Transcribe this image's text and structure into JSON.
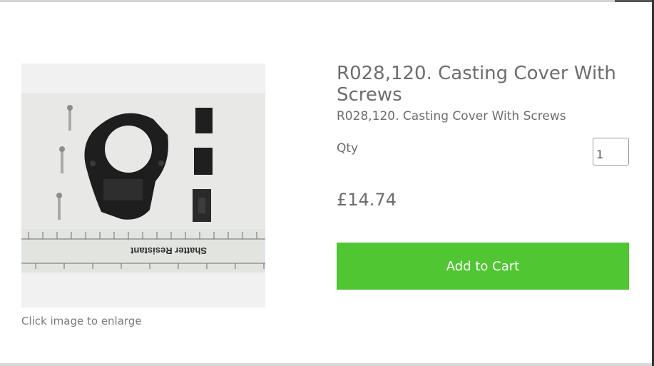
{
  "product": {
    "title": "R028,120. Casting Cover With Screws",
    "subtitle": "R028,120. Casting Cover With Screws",
    "price": "£14.74"
  },
  "image": {
    "caption": "Click image to enlarge",
    "ruler_text": "Shatter Resistant"
  },
  "qty": {
    "label": "Qty",
    "value": "1"
  },
  "cart": {
    "button_label": "Add to Cart"
  },
  "colors": {
    "button_green": "#50c633",
    "text_gray": "#6d6d6d"
  }
}
